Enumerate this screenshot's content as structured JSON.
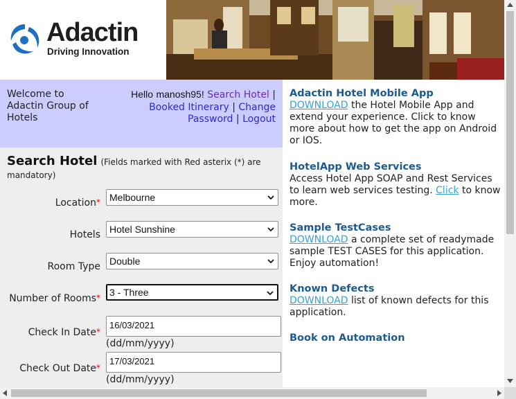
{
  "logo": {
    "name": "Adactin",
    "tagline": "Driving Innovation"
  },
  "welcome": {
    "text": "Welcome to Adactin Group of Hotels",
    "hello_prefix": "Hello",
    "username": "manosh95!",
    "links": {
      "search_hotel": "Search Hotel",
      "booked_itinerary": "Booked Itinerary",
      "change_password": "Change Password",
      "logout": "Logout"
    },
    "separator": "|"
  },
  "form": {
    "title": "Search Hotel",
    "note": "(Fields marked with Red asterix (*) are mandatory)",
    "required_mark": "*",
    "location": {
      "label": "Location",
      "value": "Melbourne"
    },
    "hotels": {
      "label": "Hotels",
      "value": "Hotel Sunshine"
    },
    "room_type": {
      "label": "Room Type",
      "value": "Double"
    },
    "rooms": {
      "label": "Number of Rooms",
      "value": "3 - Three"
    },
    "check_in": {
      "label": "Check In Date",
      "value": "16/03/2021",
      "format": "(dd/mm/yyyy)"
    },
    "check_out": {
      "label": "Check Out Date",
      "value": "17/03/2021",
      "format": "(dd/mm/yyyy)"
    }
  },
  "info": {
    "mobile": {
      "title": "Adactin Hotel Mobile App",
      "link": "DOWNLOAD",
      "text": "the Hotel Mobile App and extend your experience. Click to know more about how to get the app on Android or IOS."
    },
    "webservices": {
      "title": "HotelApp Web Services",
      "text": "Access Hotel App SOAP and Rest Services to learn web services testing.",
      "link": "Click",
      "text2": "to know more."
    },
    "testcases": {
      "title": "Sample TestCases",
      "link": "DOWNLOAD",
      "text": "a complete set of readymade sample TEST CASES for this application. Enjoy automation!"
    },
    "defects": {
      "title": "Known Defects",
      "link": "DOWNLOAD",
      "text": "list of known defects for this application."
    },
    "book": {
      "title": "Book on Automation"
    }
  },
  "colors": {
    "welcome_bg": "#ccccff",
    "form_bg": "#eeeeee",
    "heading_blue": "#1d5a8f",
    "link_blue": "#3aa0d8",
    "required_red": "#ee0000"
  }
}
